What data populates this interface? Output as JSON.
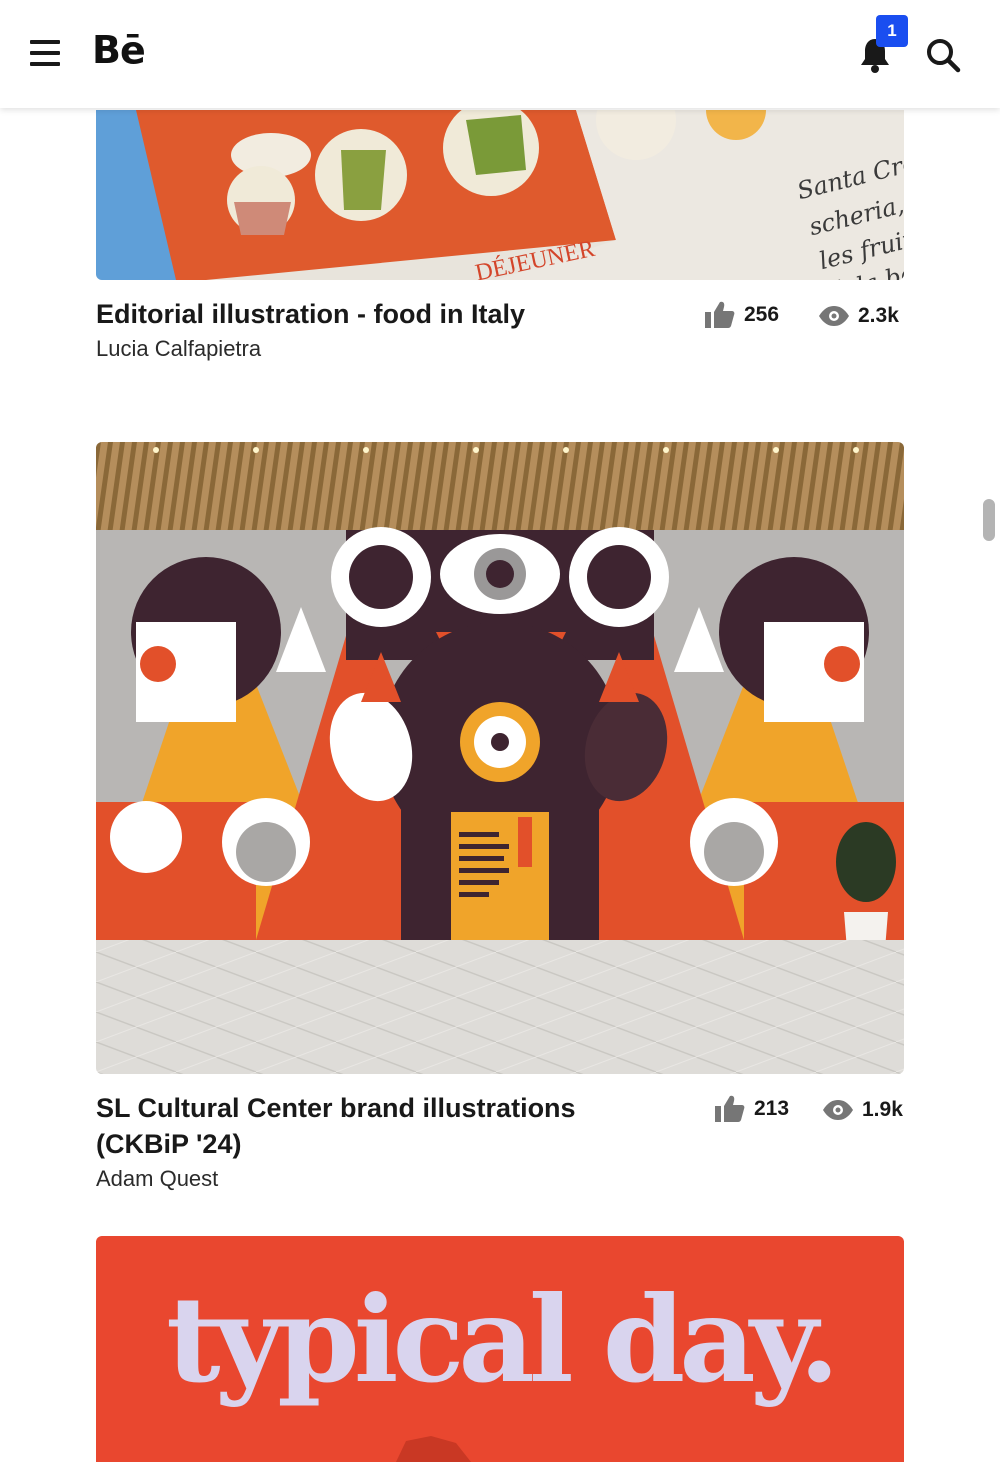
{
  "header": {
    "logo": "Bē",
    "notification_count": "1",
    "icons": [
      "hamburger-menu-icon",
      "bell-icon",
      "search-icon"
    ]
  },
  "projects": [
    {
      "title": "Editorial illustration - food in Italy",
      "owner": "Lucia Calfapietra",
      "appreciations": "256",
      "views": "2.3k",
      "image_text": {
        "heading": "DÉJEUNER",
        "lines": [
          "Santa Cro",
          "scheria, le",
          "les fruits",
          "à la bo"
        ]
      }
    },
    {
      "title_line1": "SL Cultural Center brand illustrations",
      "title_line2": "(CKBiP '24)",
      "owner": "Adam Quest",
      "appreciations": "213",
      "views": "1.9k"
    },
    {
      "image_text": "typical day."
    }
  ],
  "colors": {
    "badge": "#1a4ef0",
    "text": "#191919",
    "stat_icon": "#767676",
    "mural_orange": "#e2502a",
    "mural_yellow": "#f0a42a",
    "mural_dark": "#3e2430",
    "card3_red": "#e9472f",
    "card3_text": "#d9d4ee"
  }
}
